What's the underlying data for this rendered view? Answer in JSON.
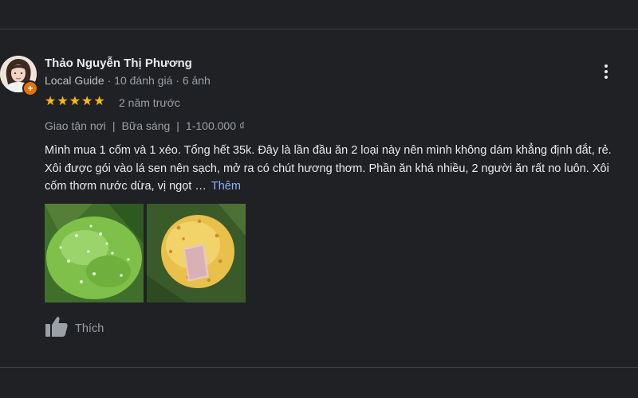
{
  "reviewer": {
    "name": "Thảo Nguyễn Thị Phương",
    "badge": "Local Guide",
    "reviews_count": "10 đánh giá",
    "photos_count": "6 ảnh",
    "separator": "·"
  },
  "rating": {
    "stars": 5,
    "time": "2 năm trước",
    "star_color": "#fbbc04"
  },
  "tags": [
    "Giao tận nơi",
    "Bữa sáng",
    "1-100.000 ₫"
  ],
  "tag_separator": "|",
  "review": {
    "text": "Mình mua 1 cốm và 1 xéo. Tổng hết 35k. Đây là lần đầu ăn 2 loại này nên mình không dám khẳng định đắt, rẻ. Xôi được gói vào lá sen nên sạch, mở ra có chút hương thơm. Phần ăn khá nhiều, 2 người ăn rất no luôn. Xôi cốm thơm nước dừa, vị ngọt …",
    "more_label": "Thêm",
    "link_color": "#8ab4f8"
  },
  "actions": {
    "like_label": "Thích"
  },
  "icons": {
    "menu": "more-vert-icon",
    "like": "thumb-up-icon",
    "badge": "local-guide-icon"
  }
}
